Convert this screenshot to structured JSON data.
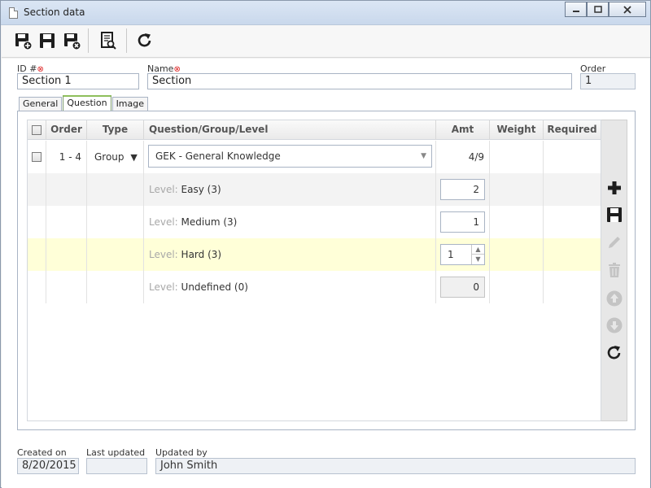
{
  "window": {
    "title": "Section data",
    "controls": [
      "minimize",
      "maximize",
      "close"
    ]
  },
  "toolbar": {
    "buttons": [
      {
        "name": "save-new-button",
        "icon": "save-new-icon"
      },
      {
        "name": "save-button",
        "icon": "save-icon"
      },
      {
        "name": "save-close-button",
        "icon": "save-close-icon"
      },
      {
        "name": "preview-button",
        "icon": "document-preview-icon"
      },
      {
        "name": "refresh-button",
        "icon": "refresh-icon"
      }
    ]
  },
  "form": {
    "id_label": "ID #",
    "id_value": "Section 1",
    "name_label": "Name",
    "name_value": "Section",
    "order_label": "Order",
    "order_value": "1"
  },
  "tabs": [
    {
      "label": "General",
      "active": false
    },
    {
      "label": "Question",
      "active": true
    },
    {
      "label": "Image",
      "active": false
    }
  ],
  "grid": {
    "columns": [
      "Order",
      "Type",
      "Question/Group/Level",
      "Amt",
      "Weight",
      "Required"
    ],
    "group_row": {
      "order": "1 - 4",
      "type": "Group",
      "question": "GEK - General Knowledge",
      "amt": "4/9"
    },
    "level_prefix": "Level:",
    "levels": [
      {
        "name": "Easy (3)",
        "amt": "2",
        "highlighted": false
      },
      {
        "name": "Medium (3)",
        "amt": "1",
        "highlighted": false
      },
      {
        "name": "Hard (3)",
        "amt": "1",
        "highlighted": true
      },
      {
        "name": "Undefined (0)",
        "amt": "0",
        "highlighted": false
      }
    ]
  },
  "sidebar": {
    "buttons": [
      "add-icon",
      "save-icon",
      "edit-icon",
      "delete-icon",
      "move-up-icon",
      "move-down-icon",
      "refresh-icon"
    ]
  },
  "footer": {
    "created_label": "Created on",
    "created_value": "8/20/2015",
    "updated_label": "Last updated",
    "updated_value": "",
    "by_label": "Updated by",
    "by_value": "John Smith"
  },
  "colors": {
    "highlight_row": "#ffffd8",
    "alt_row": "#f3f3f3",
    "required_mark": "#dd2222",
    "active_tab_accent": "#8fbf5c"
  }
}
